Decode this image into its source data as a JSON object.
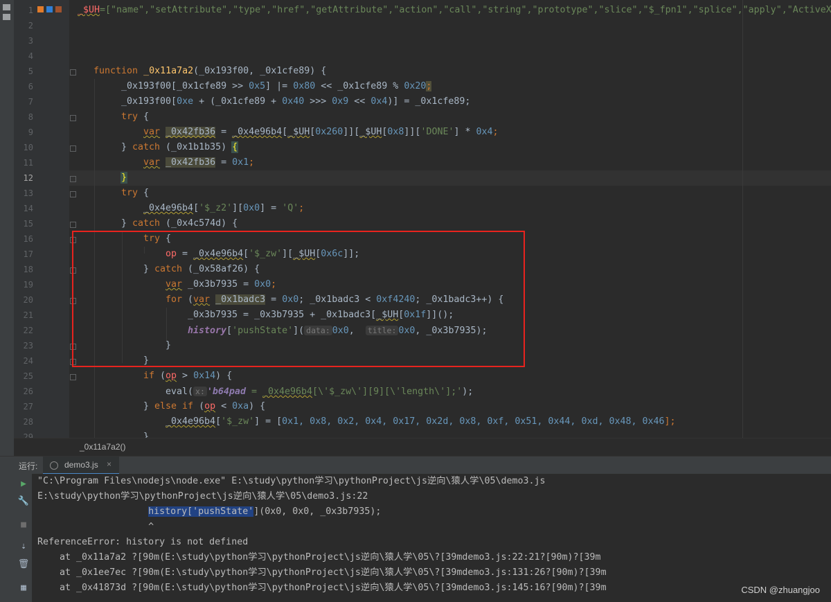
{
  "editor": {
    "line_numbers": [
      "1",
      "2",
      "3",
      "4",
      "5",
      "6",
      "7",
      "8",
      "9",
      "10",
      "11",
      "12",
      "13",
      "14",
      "15",
      "16",
      "17",
      "18",
      "19",
      "20",
      "21",
      "22",
      "23",
      "24",
      "25",
      "26",
      "27",
      "28",
      "29"
    ],
    "line1": {
      "prefix": "_$UH",
      "rest": "=[\"name\",\"setAttribute\",\"type\",\"href\",\"getAttribute\",\"action\",\"call\",\"string\",\"prototype\",\"slice\",\"$_fpn1\",\"splice\",\"apply\",\"ActiveX"
    },
    "line5": {
      "kw": "function",
      "name": "_0x11a7a2",
      "params": "(_0x193f00, _0x1cfe89) {"
    },
    "line6": {
      "a": "_0x193f00[_0x1cfe89 >> ",
      "n1": "0x5",
      "b": "] |= ",
      "n2": "0x80",
      "c": " << _0x1cfe89 % ",
      "n3": "0x20",
      "d": ";"
    },
    "line7": {
      "a": "_0x193f00[",
      "n1": "0xe",
      "b": " + (_0x1cfe89 + ",
      "n2": "0x40",
      "c": " >>> ",
      "n3": "0x9",
      "d": " << ",
      "n4": "0x4",
      "e": ")] = _0x1cfe89;"
    },
    "line8": {
      "kw": "try",
      "rest": " {"
    },
    "line9": {
      "kw": "var",
      "v": "_0x42fb36",
      "a": " = ",
      "obj": "_0x4e96b4",
      "b": "[",
      "uh1": "_$UH",
      "c": "[",
      "n1": "0x260",
      "d": "]][",
      "uh2": "_$UH",
      "e": "[",
      "n2": "0x8",
      "f": "]][",
      "s": "'DONE'",
      "g": "] * ",
      "n3": "0x4",
      "h": ";"
    },
    "line10": {
      "a": "} ",
      "kw": "catch",
      "b": " (_0x1b1b35) ",
      "brace": "{"
    },
    "line11": {
      "kw": "var",
      "v": "_0x42fb36",
      "a": " = ",
      "n": "0x1",
      "b": ";"
    },
    "line12": {
      "brace": "}"
    },
    "line13": {
      "kw": "try",
      "rest": " {"
    },
    "line14": {
      "obj": "_0x4e96b4",
      "a": "[",
      "s1": "'$_z2'",
      "b": "][",
      "n": "0x0",
      "c": "] = ",
      "s2": "'Q'",
      "d": ";"
    },
    "line15": {
      "a": "} ",
      "kw": "catch",
      "b": " (_0x4c574d) {"
    },
    "line16": {
      "kw": "try",
      "rest": " {"
    },
    "line17": {
      "op": "op",
      "a": " = ",
      "obj": "_0x4e96b4",
      "b": "[",
      "s": "'$_zw'",
      "c": "][",
      "uh": "_$UH",
      "d": "[",
      "n": "0x6c",
      "e": "]];"
    },
    "line18": {
      "a": "} ",
      "kw": "catch",
      "b": " (_0x58af26) {"
    },
    "line19": {
      "kw": "var",
      "a": " _0x3b7935 = ",
      "n": "0x0",
      "b": ";"
    },
    "line20": {
      "kw": "for",
      "a": " (",
      "kw2": "var",
      "sp": " ",
      "v": "_0x1badc3",
      "b": " = ",
      "n1": "0x0",
      "c": "; _0x1badc3 < ",
      "n2": "0xf4240",
      "d": "; _0x1badc3++) {"
    },
    "line21": {
      "a": "_0x3b7935 = _0x3b7935 + _0x1badc3[",
      "uh": "_$UH",
      "b": "[",
      "n": "0x1f",
      "c": "]]();"
    },
    "line22": {
      "fn": "history",
      "a": "[",
      "s": "'pushState'",
      "b": "](",
      "h1": "data:",
      "n1": "0x0",
      "c": ",  ",
      "h2": "title:",
      "n2": "0x0",
      "d": ", _0x3b7935);"
    },
    "line23": {
      "a": "}"
    },
    "line24": {
      "a": "}"
    },
    "line25": {
      "kw": "if",
      "a": " (",
      "op": "op",
      "b": " > ",
      "n": "0x14",
      "c": ") {"
    },
    "line26": {
      "fn": "eval",
      "a": "(",
      "hint": "x:",
      "s": "'b64pad",
      "b": " = ",
      "obj": "_0x4e96b4",
      "c": "[",
      "s2": "\\'$_zw\\'",
      "d": "][9][",
      "s3": "\\'length\\'",
      "e": "];'",
      "f": ");"
    },
    "line27": {
      "a": "} ",
      "kw": "else if",
      "b": " (",
      "op": "op",
      "c": " < ",
      "n": "0xa",
      "d": ") {"
    },
    "line28": {
      "obj": "_0x4e96b4",
      "a": "[",
      "s": "'$_zw'",
      "b": "] = [",
      "nums": "0x1, 0x8, 0x2, 0x4, 0x17, 0x2d, 0x8, 0xf, 0x51, 0x44, 0xd, 0x48, 0x46",
      "c": "];"
    },
    "line29": {
      "a": "}"
    }
  },
  "breadcrumb": "_0x11a7a2()",
  "run_panel": {
    "label": "运行:",
    "tab_label": "demo3.js",
    "tab_close": "×",
    "console_lines": [
      "\"C:\\Program Files\\nodejs\\node.exe\" E:\\study\\python学习\\pythonProject\\js逆向\\猿人学\\05\\demo3.js",
      "E:\\study\\python学习\\pythonProject\\js逆向\\猿人学\\05\\demo3.js:22",
      "",
      "                    ^",
      "ReferenceError: history is not defined",
      "    at _0x11a7a2 ?[90m(E:\\study\\python学习\\pythonProject\\js逆向\\猿人学\\05\\?[39mdemo3.js:22:21?[90m)?[39m",
      "    at _0x1ee7ec ?[90m(E:\\study\\python学习\\pythonProject\\js逆向\\猿人学\\05\\?[39mdemo3.js:131:26?[90m)?[39m",
      "    at _0x41873d ?[90m(E:\\study\\python学习\\pythonProject\\js逆向\\猿人学\\05\\?[39mdemo3.js:145:16?[90m)?[39m"
    ],
    "highlight_line": {
      "indent": "                    ",
      "sel": "history['pushState'",
      "rest": "](0x0, 0x0, _0x3b7935);"
    }
  },
  "watermark": "CSDN @zhuangjoo"
}
